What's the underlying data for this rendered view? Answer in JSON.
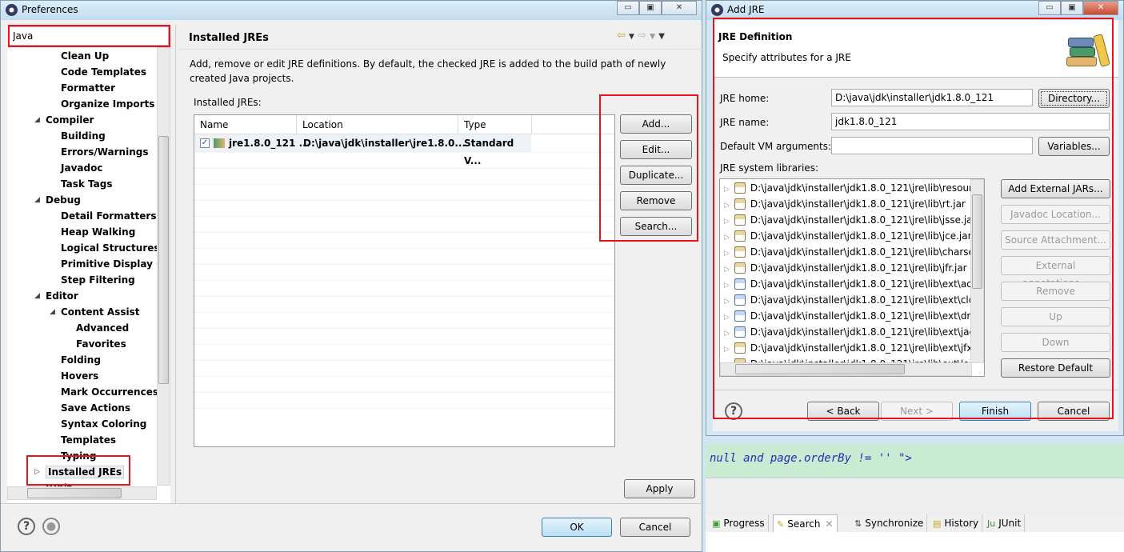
{
  "preferences": {
    "title": "Preferences",
    "filter_value": "Java",
    "tree": [
      {
        "label": "Clean Up",
        "level": 2
      },
      {
        "label": "Code Templates",
        "level": 2
      },
      {
        "label": "Formatter",
        "level": 2
      },
      {
        "label": "Organize Imports",
        "level": 2
      },
      {
        "label": "Compiler",
        "level": 1,
        "expanded": true
      },
      {
        "label": "Building",
        "level": 2
      },
      {
        "label": "Errors/Warnings",
        "level": 2
      },
      {
        "label": "Javadoc",
        "level": 2
      },
      {
        "label": "Task Tags",
        "level": 2
      },
      {
        "label": "Debug",
        "level": 1,
        "expanded": true
      },
      {
        "label": "Detail Formatters",
        "level": 2
      },
      {
        "label": "Heap Walking",
        "level": 2
      },
      {
        "label": "Logical Structures",
        "level": 2
      },
      {
        "label": "Primitive Display O",
        "level": 2
      },
      {
        "label": "Step Filtering",
        "level": 2
      },
      {
        "label": "Editor",
        "level": 1,
        "expanded": true
      },
      {
        "label": "Content Assist",
        "level": 2,
        "expanded": true
      },
      {
        "label": "Advanced",
        "level": 3
      },
      {
        "label": "Favorites",
        "level": 3
      },
      {
        "label": "Folding",
        "level": 2
      },
      {
        "label": "Hovers",
        "level": 2
      },
      {
        "label": "Mark Occurrences",
        "level": 2
      },
      {
        "label": "Save Actions",
        "level": 2
      },
      {
        "label": "Syntax Coloring",
        "level": 2
      },
      {
        "label": "Templates",
        "level": 2
      },
      {
        "label": "Typing",
        "level": 2
      },
      {
        "label": "Installed JREs",
        "level": 1,
        "expanded": false,
        "selected": true
      },
      {
        "label": "JUnit",
        "level": 1
      }
    ],
    "page_title": "Installed JREs",
    "description": "Add, remove or edit JRE definitions. By default, the checked JRE is added to the build path of newly created Java projects.",
    "table_label": "Installed JREs:",
    "columns": [
      "Name",
      "Location",
      "Type"
    ],
    "rows": [
      {
        "checked": true,
        "name": "jre1.8.0_121 ...",
        "location": "D:\\java\\jdk\\installer\\jre1.8.0...",
        "type": "Standard V..."
      }
    ],
    "side_buttons": [
      "Add...",
      "Edit...",
      "Duplicate...",
      "Remove",
      "Search..."
    ],
    "apply": "Apply",
    "ok": "OK",
    "cancel": "Cancel"
  },
  "add_jre": {
    "title": "Add JRE",
    "header_title": "JRE Definition",
    "header_subtitle": "Specify attributes for a JRE",
    "jre_home_label": "JRE home:",
    "jre_home_value": "D:\\java\\jdk\\installer\\jdk1.8.0_121",
    "directory_button": "Directory...",
    "jre_name_label": "JRE name:",
    "jre_name_value": "jdk1.8.0_121",
    "vm_args_label": "Default VM arguments:",
    "vm_args_value": "",
    "variables_button": "Variables...",
    "libraries_label": "JRE system libraries:",
    "libraries": [
      {
        "path": "D:\\java\\jdk\\installer\\jdk1.8.0_121\\jre\\lib\\resource",
        "icon": "jar-source"
      },
      {
        "path": "D:\\java\\jdk\\installer\\jdk1.8.0_121\\jre\\lib\\rt.jar",
        "icon": "jar-source"
      },
      {
        "path": "D:\\java\\jdk\\installer\\jdk1.8.0_121\\jre\\lib\\jsse.jar",
        "icon": "jar-source"
      },
      {
        "path": "D:\\java\\jdk\\installer\\jdk1.8.0_121\\jre\\lib\\jce.jar",
        "icon": "jar-source"
      },
      {
        "path": "D:\\java\\jdk\\installer\\jdk1.8.0_121\\jre\\lib\\charsets",
        "icon": "jar-source"
      },
      {
        "path": "D:\\java\\jdk\\installer\\jdk1.8.0_121\\jre\\lib\\jfr.jar",
        "icon": "jar-source"
      },
      {
        "path": "D:\\java\\jdk\\installer\\jdk1.8.0_121\\jre\\lib\\ext\\acce",
        "icon": "jar-binary"
      },
      {
        "path": "D:\\java\\jdk\\installer\\jdk1.8.0_121\\jre\\lib\\ext\\cldrc",
        "icon": "jar-binary"
      },
      {
        "path": "D:\\java\\jdk\\installer\\jdk1.8.0_121\\jre\\lib\\ext\\dnsr",
        "icon": "jar-binary"
      },
      {
        "path": "D:\\java\\jdk\\installer\\jdk1.8.0_121\\jre\\lib\\ext\\jacce",
        "icon": "jar-binary"
      },
      {
        "path": "D:\\java\\jdk\\installer\\jdk1.8.0_121\\jre\\lib\\ext\\jfxrt.",
        "icon": "jar-source"
      },
      {
        "path": "D:\\java\\jdk\\installer\\jdk1.8.0_121\\jre\\lib\\ext\\local",
        "icon": "jar-source"
      }
    ],
    "lib_buttons": [
      {
        "label": "Add External JARs...",
        "enabled": true
      },
      {
        "label": "Javadoc Location...",
        "enabled": false
      },
      {
        "label": "Source Attachment...",
        "enabled": false
      },
      {
        "label": "External annotations...",
        "enabled": false
      },
      {
        "label": "Remove",
        "enabled": false
      },
      {
        "label": "Up",
        "enabled": false
      },
      {
        "label": "Down",
        "enabled": false
      },
      {
        "label": "Restore Default",
        "enabled": true
      }
    ],
    "back": "< Back",
    "next": "Next >",
    "finish": "Finish",
    "cancel": "Cancel"
  },
  "editor": {
    "code_line": "null and page.orderBy != '' \">"
  },
  "bottom_tabs": [
    "Progress",
    "Search",
    "Synchronize",
    "History",
    "JUnit"
  ],
  "colors": {
    "highlight": "#e8141c",
    "code": "#2a2ab8",
    "editor_bg": "#c9ebd2"
  }
}
